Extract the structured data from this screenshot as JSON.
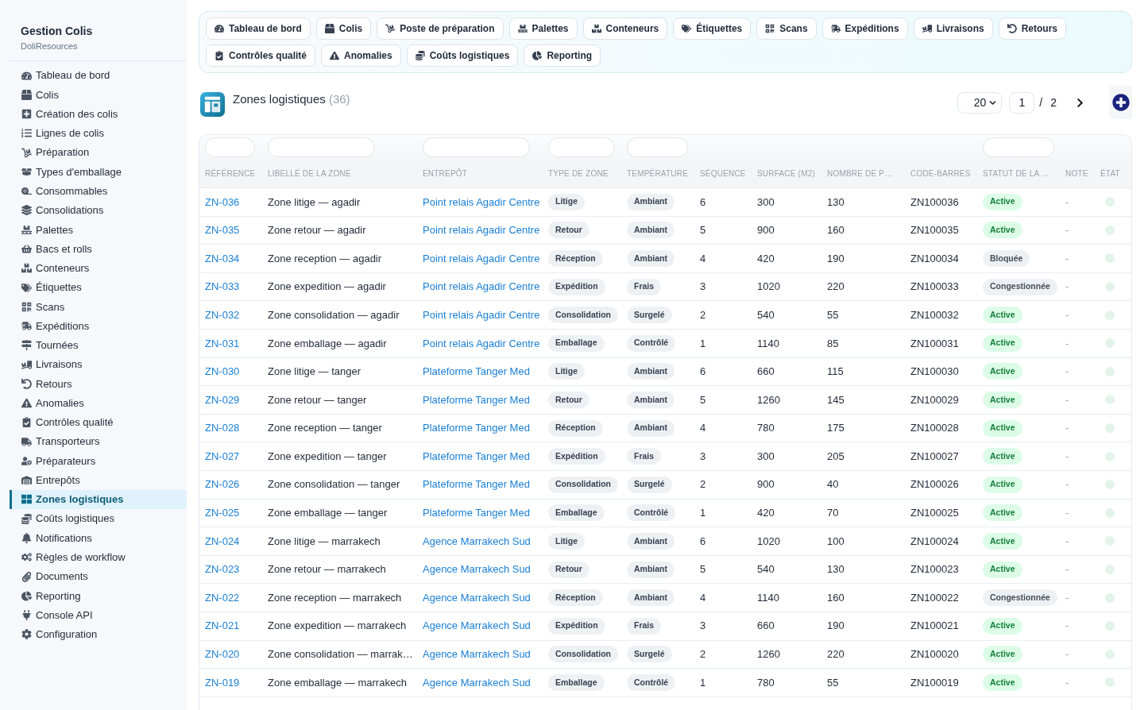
{
  "sidebar": {
    "title": "Gestion Colis",
    "subtitle": "DoliResources",
    "items": [
      {
        "label": "Tableau de bord",
        "selected": false
      },
      {
        "label": "Colis",
        "selected": false
      },
      {
        "label": "Création des colis",
        "selected": false
      },
      {
        "label": "Lignes de colis",
        "selected": false
      },
      {
        "label": "Préparation",
        "selected": false
      },
      {
        "label": "Types d'emballage",
        "selected": false
      },
      {
        "label": "Consommables",
        "selected": false
      },
      {
        "label": "Consolidations",
        "selected": false
      },
      {
        "label": "Palettes",
        "selected": false
      },
      {
        "label": "Bacs et rolls",
        "selected": false
      },
      {
        "label": "Conteneurs",
        "selected": false
      },
      {
        "label": "Étiquettes",
        "selected": false
      },
      {
        "label": "Scans",
        "selected": false
      },
      {
        "label": "Expéditions",
        "selected": false
      },
      {
        "label": "Tournées",
        "selected": false
      },
      {
        "label": "Livraisons",
        "selected": false
      },
      {
        "label": "Retours",
        "selected": false
      },
      {
        "label": "Anomalies",
        "selected": false
      },
      {
        "label": "Contrôles qualité",
        "selected": false
      },
      {
        "label": "Transporteurs",
        "selected": false
      },
      {
        "label": "Préparateurs",
        "selected": false
      },
      {
        "label": "Entrepôts",
        "selected": false
      },
      {
        "label": "Zones logistiques",
        "selected": true
      },
      {
        "label": "Coûts logistiques",
        "selected": false
      },
      {
        "label": "Notifications",
        "selected": false
      },
      {
        "label": "Règles de workflow",
        "selected": false
      },
      {
        "label": "Documents",
        "selected": false
      },
      {
        "label": "Reporting",
        "selected": false
      },
      {
        "label": "Console API",
        "selected": false
      },
      {
        "label": "Configuration",
        "selected": false
      }
    ]
  },
  "top_nav": [
    "Tableau de bord",
    "Colis",
    "Poste de préparation",
    "Palettes",
    "Conteneurs",
    "Étiquettes",
    "Scans",
    "Expéditions",
    "Livraisons",
    "Retours",
    "Contrôles qualité",
    "Anomalies",
    "Coûts logistiques",
    "Reporting"
  ],
  "page": {
    "title": "Zones logistiques",
    "count": "(36)",
    "pagination": {
      "page_size": "20",
      "page": "1",
      "separator": "/",
      "total_pages": "2"
    }
  },
  "table": {
    "columns": [
      {
        "label": "RÉFÉRENCE",
        "filterable": true
      },
      {
        "label": "LIBELLÉ DE LA ZONE",
        "filterable": true
      },
      {
        "label": "ENTREPÔT",
        "filterable": true
      },
      {
        "label": "TYPE DE ZONE",
        "filterable": true
      },
      {
        "label": "TEMPÉRATURE",
        "filterable": true
      },
      {
        "label": "SÉQUENCE",
        "filterable": false
      },
      {
        "label": "SURFACE (M2)",
        "filterable": false
      },
      {
        "label": "NOMBRE DE P…",
        "filterable": false
      },
      {
        "label": "CODE-BARRES",
        "filterable": false
      },
      {
        "label": "STATUT DE LA …",
        "filterable": true
      },
      {
        "label": "NOTE",
        "filterable": false
      },
      {
        "label": "ÉTAT",
        "filterable": false
      }
    ],
    "rows": [
      {
        "reference": "ZN-036",
        "libelle": "Zone litige — agadir",
        "entrepot": "Point relais Agadir Centre",
        "type": "Litige",
        "temperature": "Ambiant",
        "sequence": "6",
        "surface": "300",
        "nombre": "130",
        "code_barres": "ZN100036",
        "statut": {
          "label": "Active",
          "color": "#dcfce7"
        },
        "note": "-",
        "etat_on": true
      },
      {
        "reference": "ZN-035",
        "libelle": "Zone retour — agadir",
        "entrepot": "Point relais Agadir Centre",
        "type": "Retour",
        "temperature": "Ambiant",
        "sequence": "5",
        "surface": "900",
        "nombre": "160",
        "code_barres": "ZN100035",
        "statut": {
          "label": "Active",
          "color": "#dcfce7"
        },
        "note": "-",
        "etat_on": true
      },
      {
        "reference": "ZN-034",
        "libelle": "Zone reception — agadir",
        "entrepot": "Point relais Agadir Centre",
        "type": "Réception",
        "temperature": "Ambiant",
        "sequence": "4",
        "surface": "420",
        "nombre": "190",
        "code_barres": "ZN100034",
        "statut": {
          "label": "Bloquée",
          "color": "#eef1f4"
        },
        "note": "-",
        "etat_on": true
      },
      {
        "reference": "ZN-033",
        "libelle": "Zone expedition — agadir",
        "entrepot": "Point relais Agadir Centre",
        "type": "Expédition",
        "temperature": "Frais",
        "sequence": "3",
        "surface": "1020",
        "nombre": "220",
        "code_barres": "ZN100033",
        "statut": {
          "label": "Congestionnée",
          "color": "#eef1f4"
        },
        "note": "-",
        "etat_on": true
      },
      {
        "reference": "ZN-032",
        "libelle": "Zone consolidation — agadir",
        "entrepot": "Point relais Agadir Centre",
        "type": "Consolidation",
        "temperature": "Surgelé",
        "sequence": "2",
        "surface": "540",
        "nombre": "55",
        "code_barres": "ZN100032",
        "statut": {
          "label": "Active",
          "color": "#dcfce7"
        },
        "note": "-",
        "etat_on": true
      },
      {
        "reference": "ZN-031",
        "libelle": "Zone emballage — agadir",
        "entrepot": "Point relais Agadir Centre",
        "type": "Emballage",
        "temperature": "Contrôlé",
        "sequence": "1",
        "surface": "1140",
        "nombre": "85",
        "code_barres": "ZN100031",
        "statut": {
          "label": "Active",
          "color": "#dcfce7"
        },
        "note": "-",
        "etat_on": true
      },
      {
        "reference": "ZN-030",
        "libelle": "Zone litige — tanger",
        "entrepot": "Plateforme Tanger Med",
        "type": "Litige",
        "temperature": "Ambiant",
        "sequence": "6",
        "surface": "660",
        "nombre": "115",
        "code_barres": "ZN100030",
        "statut": {
          "label": "Active",
          "color": "#dcfce7"
        },
        "note": "-",
        "etat_on": true
      },
      {
        "reference": "ZN-029",
        "libelle": "Zone retour — tanger",
        "entrepot": "Plateforme Tanger Med",
        "type": "Retour",
        "temperature": "Ambiant",
        "sequence": "5",
        "surface": "1260",
        "nombre": "145",
        "code_barres": "ZN100029",
        "statut": {
          "label": "Active",
          "color": "#dcfce7"
        },
        "note": "-",
        "etat_on": true
      },
      {
        "reference": "ZN-028",
        "libelle": "Zone reception — tanger",
        "entrepot": "Plateforme Tanger Med",
        "type": "Réception",
        "temperature": "Ambiant",
        "sequence": "4",
        "surface": "780",
        "nombre": "175",
        "code_barres": "ZN100028",
        "statut": {
          "label": "Active",
          "color": "#dcfce7"
        },
        "note": "-",
        "etat_on": true
      },
      {
        "reference": "ZN-027",
        "libelle": "Zone expedition — tanger",
        "entrepot": "Plateforme Tanger Med",
        "type": "Expédition",
        "temperature": "Frais",
        "sequence": "3",
        "surface": "300",
        "nombre": "205",
        "code_barres": "ZN100027",
        "statut": {
          "label": "Active",
          "color": "#dcfce7"
        },
        "note": "-",
        "etat_on": true
      },
      {
        "reference": "ZN-026",
        "libelle": "Zone consolidation — tanger",
        "entrepot": "Plateforme Tanger Med",
        "type": "Consolidation",
        "temperature": "Surgelé",
        "sequence": "2",
        "surface": "900",
        "nombre": "40",
        "code_barres": "ZN100026",
        "statut": {
          "label": "Active",
          "color": "#dcfce7"
        },
        "note": "-",
        "etat_on": true
      },
      {
        "reference": "ZN-025",
        "libelle": "Zone emballage — tanger",
        "entrepot": "Plateforme Tanger Med",
        "type": "Emballage",
        "temperature": "Contrôlé",
        "sequence": "1",
        "surface": "420",
        "nombre": "70",
        "code_barres": "ZN100025",
        "statut": {
          "label": "Active",
          "color": "#dcfce7"
        },
        "note": "-",
        "etat_on": true
      },
      {
        "reference": "ZN-024",
        "libelle": "Zone litige — marrakech",
        "entrepot": "Agence Marrakech Sud",
        "type": "Litige",
        "temperature": "Ambiant",
        "sequence": "6",
        "surface": "1020",
        "nombre": "100",
        "code_barres": "ZN100024",
        "statut": {
          "label": "Active",
          "color": "#dcfce7"
        },
        "note": "-",
        "etat_on": true
      },
      {
        "reference": "ZN-023",
        "libelle": "Zone retour — marrakech",
        "entrepot": "Agence Marrakech Sud",
        "type": "Retour",
        "temperature": "Ambiant",
        "sequence": "5",
        "surface": "540",
        "nombre": "130",
        "code_barres": "ZN100023",
        "statut": {
          "label": "Active",
          "color": "#dcfce7"
        },
        "note": "-",
        "etat_on": true
      },
      {
        "reference": "ZN-022",
        "libelle": "Zone reception — marrakech",
        "entrepot": "Agence Marrakech Sud",
        "type": "Réception",
        "temperature": "Ambiant",
        "sequence": "4",
        "surface": "1140",
        "nombre": "160",
        "code_barres": "ZN100022",
        "statut": {
          "label": "Congestionnée",
          "color": "#eef1f4"
        },
        "note": "-",
        "etat_on": true
      },
      {
        "reference": "ZN-021",
        "libelle": "Zone expedition — marrakech",
        "entrepot": "Agence Marrakech Sud",
        "type": "Expédition",
        "temperature": "Frais",
        "sequence": "3",
        "surface": "660",
        "nombre": "190",
        "code_barres": "ZN100021",
        "statut": {
          "label": "Active",
          "color": "#dcfce7"
        },
        "note": "-",
        "etat_on": true
      },
      {
        "reference": "ZN-020",
        "libelle": "Zone consolidation — marrak…",
        "entrepot": "Agence Marrakech Sud",
        "type": "Consolidation",
        "temperature": "Surgelé",
        "sequence": "2",
        "surface": "1260",
        "nombre": "220",
        "code_barres": "ZN100020",
        "statut": {
          "label": "Active",
          "color": "#dcfce7"
        },
        "note": "-",
        "etat_on": true
      },
      {
        "reference": "ZN-019",
        "libelle": "Zone emballage — marrakech",
        "entrepot": "Agence Marrakech Sud",
        "type": "Emballage",
        "temperature": "Contrôlé",
        "sequence": "1",
        "surface": "780",
        "nombre": "55",
        "code_barres": "ZN100019",
        "statut": {
          "label": "Active",
          "color": "#dcfce7"
        },
        "note": "-",
        "etat_on": true
      }
    ]
  }
}
